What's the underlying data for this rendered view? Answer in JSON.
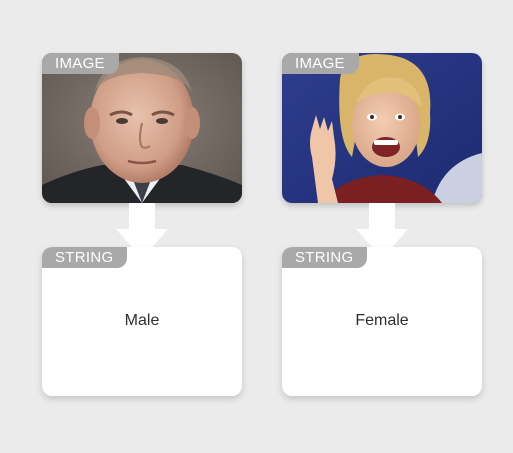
{
  "columns": [
    {
      "input": {
        "type_label": "IMAGE"
      },
      "output": {
        "type_label": "STRING",
        "value": "Male"
      }
    },
    {
      "input": {
        "type_label": "IMAGE"
      },
      "output": {
        "type_label": "STRING",
        "value": "Female"
      }
    }
  ],
  "colors": {
    "background": "#ebebeb",
    "tag": "#a9a9a9",
    "card": "#ffffff",
    "arrow": "#ffffff"
  }
}
